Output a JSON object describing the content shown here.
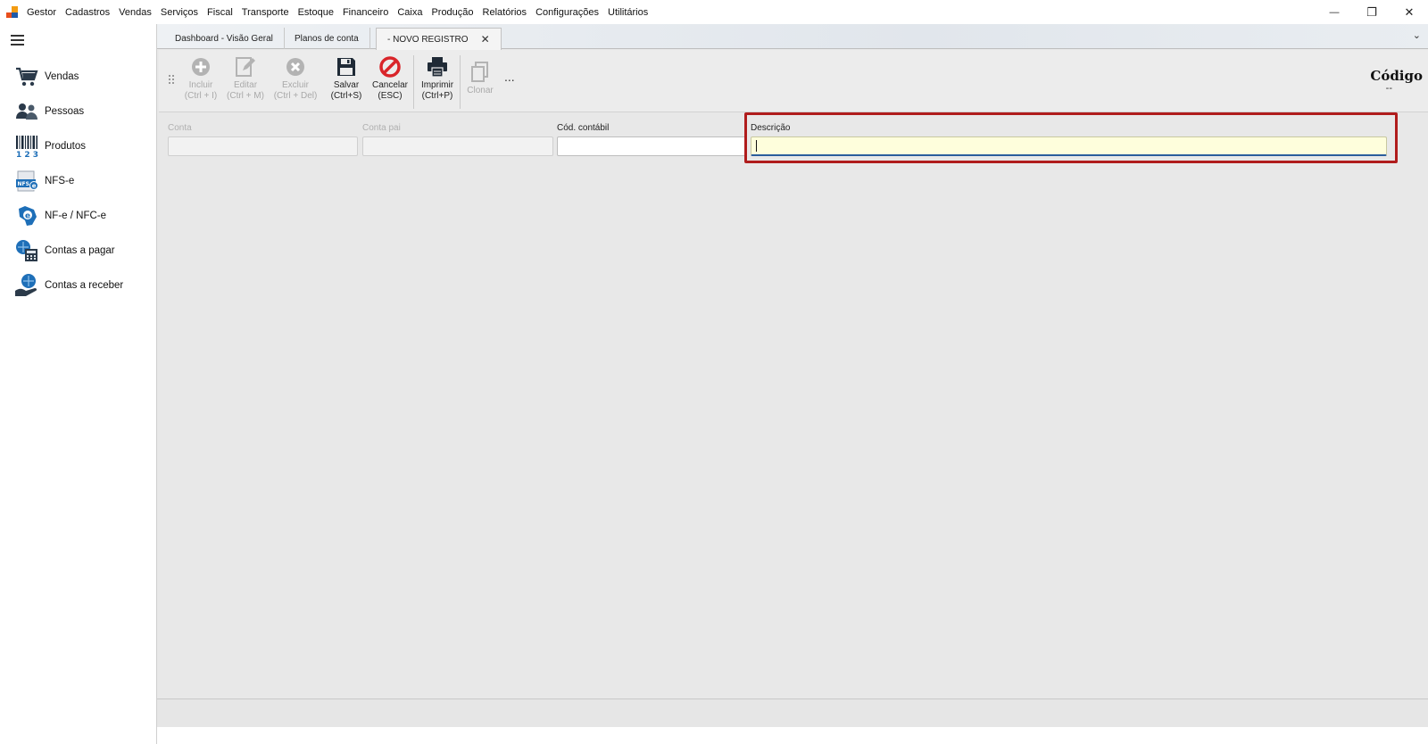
{
  "menubar": {
    "app_name": "Gestor",
    "items": [
      "Cadastros",
      "Vendas",
      "Serviços",
      "Fiscal",
      "Transporte",
      "Estoque",
      "Financeiro",
      "Caixa",
      "Produção",
      "Relatórios",
      "Configurações",
      "Utilitários"
    ],
    "window_controls": {
      "minimize": "—",
      "restore": "❐",
      "close": "✕"
    }
  },
  "sidebar": {
    "items": [
      {
        "label": "Vendas",
        "icon": "cart-icon"
      },
      {
        "label": "Pessoas",
        "icon": "people-icon"
      },
      {
        "label": "Produtos",
        "icon": "barcode-icon"
      },
      {
        "label": "NFS-e",
        "icon": "nfse-icon"
      },
      {
        "label": "NF-e / NFC-e",
        "icon": "nfe-icon"
      },
      {
        "label": "Contas a pagar",
        "icon": "payables-icon"
      },
      {
        "label": "Contas a receber",
        "icon": "receivables-icon"
      }
    ]
  },
  "tabs": [
    {
      "label": "Dashboard - Visão Geral",
      "active": false
    },
    {
      "label": "Planos de conta",
      "active": false
    },
    {
      "label": "- NOVO REGISTRO",
      "active": true,
      "close": "✕"
    }
  ],
  "tab_menu": "⌄",
  "toolbar": {
    "buttons": [
      {
        "label1": "Incluir",
        "label2": "(Ctrl + I)",
        "enabled": false
      },
      {
        "label1": "Editar",
        "label2": "(Ctrl + M)",
        "enabled": false
      },
      {
        "label1": "Excluir",
        "label2": "(Ctrl + Del)",
        "enabled": false
      },
      {
        "label1": "Salvar",
        "label2": "(Ctrl+S)",
        "enabled": true
      },
      {
        "label1": "Cancelar",
        "label2": "(ESC)",
        "enabled": true
      },
      {
        "label1": "Imprimir",
        "label2": "(Ctrl+P)",
        "enabled": true
      },
      {
        "label1": "Clonar",
        "label2": "",
        "enabled": false
      }
    ],
    "more": "...",
    "code_title": "Código",
    "code_value": "--"
  },
  "form": {
    "fields": [
      {
        "label": "Conta",
        "value": "",
        "enabled": false
      },
      {
        "label": "Conta pai",
        "value": "",
        "enabled": false
      },
      {
        "label": "Cód. contábil",
        "value": "",
        "enabled": true
      },
      {
        "label": "Descrição",
        "value": "",
        "enabled": true,
        "focused": true
      }
    ]
  },
  "colors": {
    "highlight": "#b01c1c",
    "focused_input": "#fefedc",
    "cancel_red": "#d9252a"
  }
}
